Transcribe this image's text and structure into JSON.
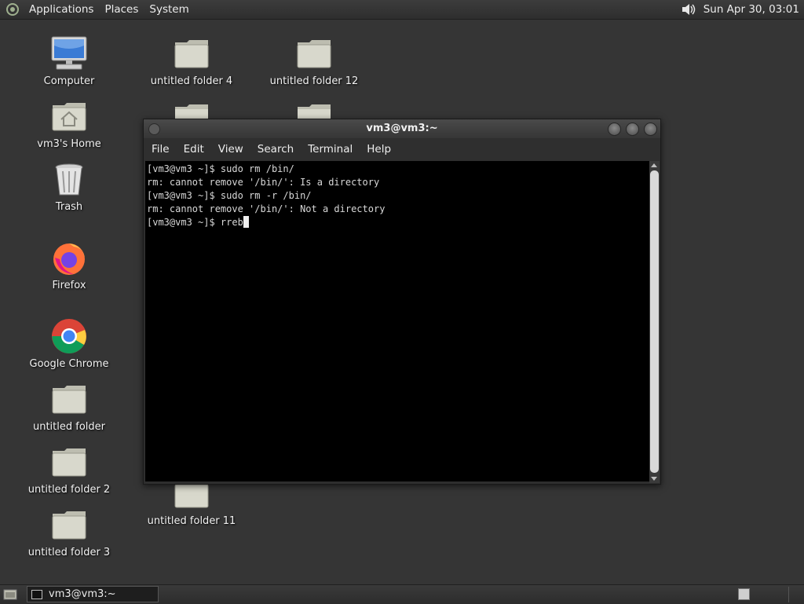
{
  "top_panel": {
    "menus": [
      "Applications",
      "Places",
      "System"
    ],
    "clock": "Sun Apr 30, 03:01"
  },
  "desktop_icons": {
    "computer": "Computer",
    "home": "vm3's Home",
    "trash": "Trash",
    "firefox": "Firefox",
    "chrome": "Google Chrome",
    "folder_1": "untitled folder",
    "folder_2": "untitled folder 2",
    "folder_3": "untitled folder 3",
    "folder_4": "untitled folder 4",
    "folder_11": "untitled folder 11",
    "folder_12": "untitled folder 12"
  },
  "terminal": {
    "title": "vm3@vm3:~",
    "menu": [
      "File",
      "Edit",
      "View",
      "Search",
      "Terminal",
      "Help"
    ],
    "lines": [
      "[vm3@vm3 ~]$ sudo rm /bin/",
      "rm: cannot remove '/bin/': Is a directory",
      "[vm3@vm3 ~]$ sudo rm -r /bin/",
      "rm: cannot remove '/bin/': Not a directory"
    ],
    "prompt": "[vm3@vm3 ~]$ ",
    "current_input": "rreb"
  },
  "taskbar": {
    "window_button": "vm3@vm3:~"
  },
  "colors": {
    "desktop_bg": "#353535",
    "folder": "#d8d8cc",
    "terminal_bg": "#000000",
    "terminal_fg": "#d8d8d8"
  }
}
